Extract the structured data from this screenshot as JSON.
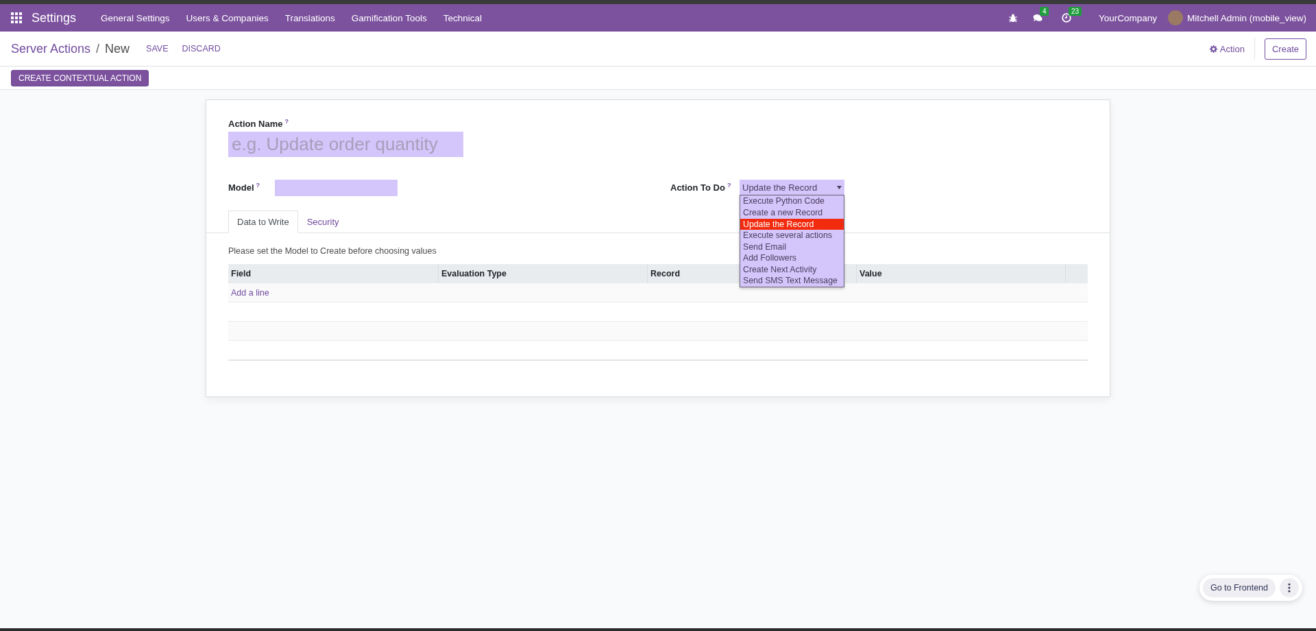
{
  "navbar": {
    "app_title": "Settings",
    "menu": [
      "General Settings",
      "Users & Companies",
      "Translations",
      "Gamification Tools",
      "Technical"
    ],
    "chat_count": "4",
    "activity_count": "23",
    "company": "YourCompany",
    "user": "Mitchell Admin (mobile_view)"
  },
  "control_panel": {
    "breadcrumb": [
      "Server Actions",
      "New"
    ],
    "separator": "/",
    "buttons": [
      "SAVE",
      "DISCARD"
    ],
    "action_menu": "Action",
    "create": "Create"
  },
  "contextual_button": "CREATE CONTEXTUAL ACTION",
  "form": {
    "action_name": {
      "label": "Action Name",
      "help": "?",
      "placeholder": "e.g. Update order quantity"
    },
    "model": {
      "label": "Model",
      "help": "?"
    },
    "action_to_do": {
      "label": "Action To Do",
      "help": "?",
      "value": "Update the Record",
      "expanded": true,
      "options": [
        {
          "label": "Execute Python Code",
          "selected": false
        },
        {
          "label": "Create a new Record",
          "selected": false
        },
        {
          "label": "Update the Record",
          "selected": true
        },
        {
          "label": "Execute several actions",
          "selected": false
        },
        {
          "label": "Send Email",
          "selected": false
        },
        {
          "label": "Add Followers",
          "selected": false
        },
        {
          "label": "Create Next Activity",
          "selected": false
        },
        {
          "label": "Send SMS Text Message",
          "selected": false
        }
      ]
    },
    "tabs": [
      {
        "label": "Data to Write",
        "selected": true
      },
      {
        "label": "Security",
        "selected": false
      }
    ],
    "notice": "Please set the Model to Create before choosing values",
    "table": {
      "columns": [
        "Field",
        "Evaluation Type",
        "Record",
        "Value"
      ],
      "add_line": "Add a line"
    }
  },
  "frontend_button": "Go to Frontend"
}
